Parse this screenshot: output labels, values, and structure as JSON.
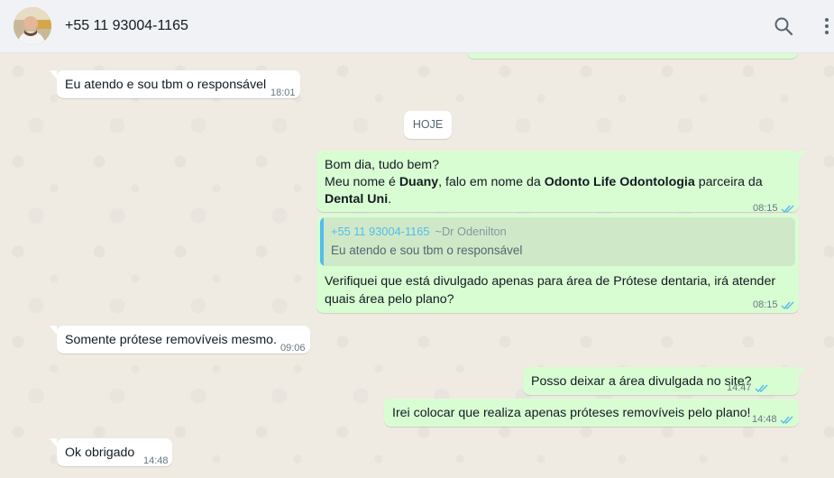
{
  "header": {
    "contact_name": "+55 11 93004-1165"
  },
  "icons": {
    "search": "search-icon",
    "menu": "menu-icon",
    "read_ticks": "double-check-icon"
  },
  "colors": {
    "incoming_bubble": "#ffffff",
    "outgoing_bubble": "#d9fdd3",
    "chat_background": "#efeae2",
    "header_background": "#f0f2f5",
    "read_ticks": "#53bdeb",
    "quote_accent": "#53bdeb"
  },
  "day_separator": "HOJE",
  "messages": [
    {
      "direction": "in",
      "text": "Eu atendo e sou tbm o responsável",
      "time": "18:01"
    },
    {
      "direction": "out",
      "line1": "Bom dia, tudo bem?",
      "line2_a": "Meu nome é ",
      "line2_b": "Duany",
      "line2_c": ", falo em nome da ",
      "line2_d": "Odonto Life Odontologia",
      "line2_e": " parceira da",
      "line3_a": "Dental Uni",
      "line3_b": ".",
      "time": "08:15"
    },
    {
      "direction": "out",
      "quote": {
        "sender": "+55 11 93004-1165",
        "alias": "~Dr Odenilton",
        "text": "Eu atendo e sou tbm o responsável"
      },
      "line1": "Verifiquei que está divulgado apenas para área de Prótese dentaria, irá atender",
      "line2": "quais área pelo plano?",
      "time": "08:15"
    },
    {
      "direction": "in",
      "text": "Somente prótese removíveis mesmo.",
      "time": "09:06"
    },
    {
      "direction": "out",
      "text": "Posso deixar a área divulgada no site?",
      "time": "14:47"
    },
    {
      "direction": "out",
      "text": "Irei colocar que realiza apenas próteses removíveis pelo plano!",
      "time": "14:48"
    },
    {
      "direction": "in",
      "text": "Ok obrigado",
      "time": "14:48"
    }
  ]
}
